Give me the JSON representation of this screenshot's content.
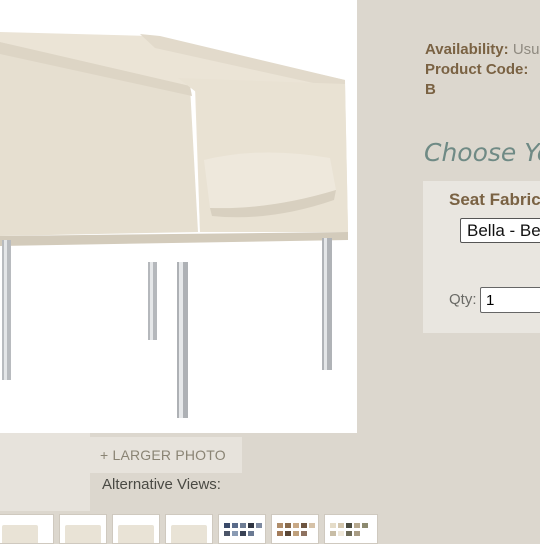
{
  "product": {
    "image_alt": "beige armchair with chrome legs",
    "larger_photo_label": "+ LARGER PHOTO",
    "alt_views_label": "Alternative Views:",
    "availability_label": "Availability:",
    "availability_value": "Usu",
    "product_code_label": "Product Code:",
    "product_code_value": "B"
  },
  "options": {
    "heading": "Choose Yo",
    "seat_fabric_label": "Seat Fabric",
    "seat_fabric_selected": "Bella - Be",
    "qty_label": "Qty:",
    "qty_value": "1"
  },
  "thumbnails": [
    {
      "name": "thumb-chair-1",
      "kind": "chair"
    },
    {
      "name": "thumb-chair-2",
      "kind": "chair"
    },
    {
      "name": "thumb-chair-3",
      "kind": "chair"
    },
    {
      "name": "thumb-chair-4",
      "kind": "chair"
    },
    {
      "name": "thumb-swatch-dark",
      "kind": "swatch"
    },
    {
      "name": "thumb-swatch-warm",
      "kind": "swatch"
    },
    {
      "name": "thumb-swatch-light",
      "kind": "swatch"
    }
  ],
  "colors": {
    "background": "#dcd7ce",
    "label_brown": "#7a6243",
    "heading_teal": "#6f8a85"
  }
}
